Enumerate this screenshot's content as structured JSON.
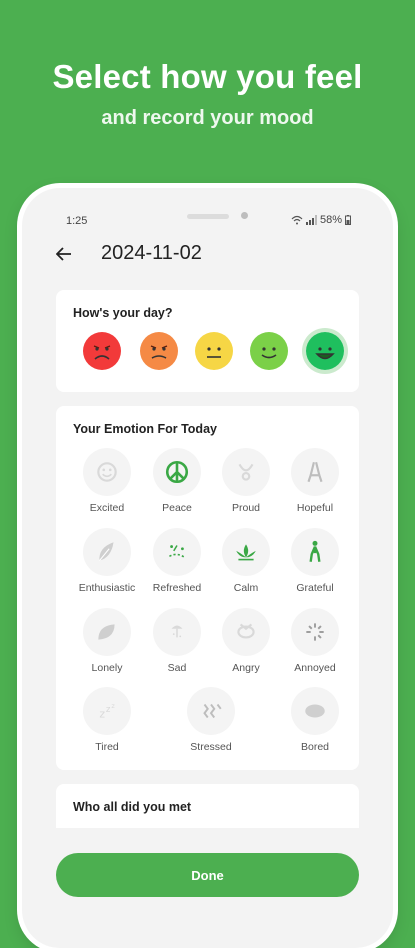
{
  "promo": {
    "headline": "Select how you feel",
    "subline": "and record your mood"
  },
  "status_bar": {
    "time": "1:25",
    "battery": "58%"
  },
  "header": {
    "back_icon": "arrow-left-icon",
    "date": "2024-11-02"
  },
  "day_card": {
    "title": "How's your day?",
    "moods": [
      {
        "name": "very-bad",
        "color": "#f23a3a",
        "selected": false
      },
      {
        "name": "bad",
        "color": "#f58a45",
        "selected": false
      },
      {
        "name": "neutral",
        "color": "#f6d645",
        "selected": false
      },
      {
        "name": "good",
        "color": "#7bd048",
        "selected": false
      },
      {
        "name": "great",
        "color": "#1fbf5e",
        "selected": true
      }
    ]
  },
  "emotion_card": {
    "title": "Your Emotion For Today",
    "emotions": [
      {
        "label": "Excited",
        "icon": "excited-icon",
        "selected": false
      },
      {
        "label": "Peace",
        "icon": "peace-icon",
        "selected": true
      },
      {
        "label": "Proud",
        "icon": "proud-icon",
        "selected": false
      },
      {
        "label": "Hopeful",
        "icon": "hopeful-icon",
        "selected": false
      },
      {
        "label": "Enthusiastic",
        "icon": "feather-icon",
        "selected": false
      },
      {
        "label": "Refreshed",
        "icon": "refreshed-icon",
        "selected": true
      },
      {
        "label": "Calm",
        "icon": "lotus-icon",
        "selected": true
      },
      {
        "label": "Grateful",
        "icon": "praying-person-icon",
        "selected": true
      },
      {
        "label": "Lonely",
        "icon": "leaf-icon",
        "selected": false
      },
      {
        "label": "Sad",
        "icon": "sad-icon",
        "selected": false
      },
      {
        "label": "Angry",
        "icon": "angry-icon",
        "selected": false
      },
      {
        "label": "Annoyed",
        "icon": "annoyed-icon",
        "selected": false
      },
      {
        "label": "Tired",
        "icon": "sleep-icon",
        "selected": false
      },
      {
        "label": "Stressed",
        "icon": "stressed-icon",
        "selected": false
      },
      {
        "label": "Bored",
        "icon": "bored-icon",
        "selected": false
      }
    ]
  },
  "met_card": {
    "title": "Who all did you met"
  },
  "done_label": "Done",
  "accent": "#4caf50"
}
